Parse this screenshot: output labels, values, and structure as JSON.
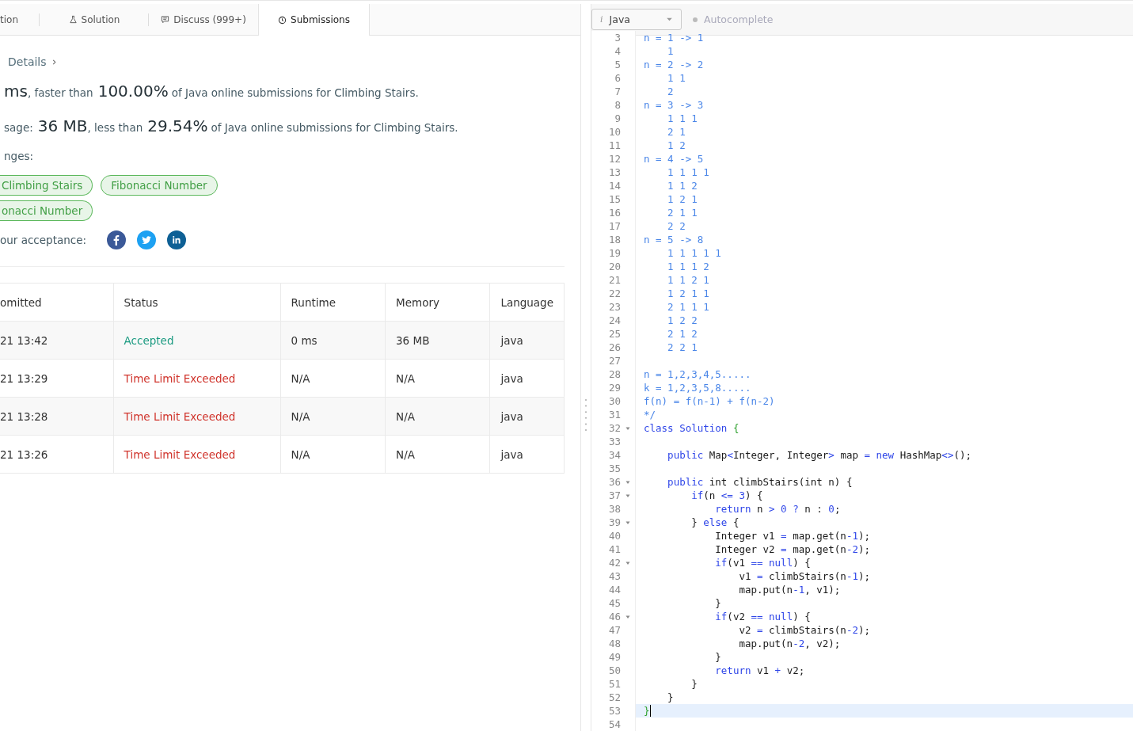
{
  "tabs": [
    {
      "label": "tion",
      "selected": false
    },
    {
      "label": "Solution",
      "selected": false
    },
    {
      "label": "Discuss (999+)",
      "selected": false
    },
    {
      "label": "Submissions",
      "selected": true
    }
  ],
  "details_link": "Details",
  "runtime": {
    "value": "ms",
    "mid": ", faster than",
    "percent": "100.00%",
    "suffix": "of Java online submissions for Climbing Stairs."
  },
  "memory": {
    "label": "sage:",
    "value": "36 MB",
    "mid": ", less than",
    "percent": "29.54%",
    "suffix": "of Java online submissions for Climbing Stairs."
  },
  "challenges": {
    "label": "nges:",
    "tag_rows": [
      [
        "Climbing Stairs",
        "Fibonacci Number"
      ],
      [
        "onacci Number"
      ]
    ]
  },
  "share": {
    "label": "our acceptance:",
    "networks": [
      {
        "kind": "facebook",
        "color": "#3b5998"
      },
      {
        "kind": "twitter",
        "color": "#1da1f2"
      },
      {
        "kind": "linkedin",
        "color": "#0e6095"
      }
    ]
  },
  "table": {
    "columns": [
      "omitted",
      "Status",
      "Runtime",
      "Memory",
      "Language"
    ],
    "rows": [
      {
        "submitted": "21 13:42",
        "status": "Accepted",
        "kind": "accepted",
        "runtime": "0 ms",
        "memory": "36 MB",
        "language": "java"
      },
      {
        "submitted": "21 13:29",
        "status": "Time Limit Exceeded",
        "kind": "error",
        "runtime": "N/A",
        "memory": "N/A",
        "language": "java"
      },
      {
        "submitted": "21 13:28",
        "status": "Time Limit Exceeded",
        "kind": "error",
        "runtime": "N/A",
        "memory": "N/A",
        "language": "java"
      },
      {
        "submitted": "21 13:26",
        "status": "Time Limit Exceeded",
        "kind": "error",
        "runtime": "N/A",
        "memory": "N/A",
        "language": "java"
      }
    ]
  },
  "editor": {
    "language_icon": "i",
    "language": "Java",
    "autocomplete": {
      "label": "Autocomplete",
      "on": false
    },
    "lines": [
      {
        "number": "3",
        "fold": false,
        "current": false,
        "tokens": [
          {
            "kind": "comment",
            "text": "n = 1 -> 1"
          }
        ]
      },
      {
        "number": "4",
        "fold": false,
        "current": false,
        "tokens": [
          {
            "kind": "comment",
            "text": "    1"
          }
        ]
      },
      {
        "number": "5",
        "fold": false,
        "current": false,
        "tokens": [
          {
            "kind": "comment",
            "text": "n = 2 -> 2"
          }
        ]
      },
      {
        "number": "6",
        "fold": false,
        "current": false,
        "tokens": [
          {
            "kind": "comment",
            "text": "    1 1"
          }
        ]
      },
      {
        "number": "7",
        "fold": false,
        "current": false,
        "tokens": [
          {
            "kind": "comment",
            "text": "    2"
          }
        ]
      },
      {
        "number": "8",
        "fold": false,
        "current": false,
        "tokens": [
          {
            "kind": "comment",
            "text": "n = 3 -> 3"
          }
        ]
      },
      {
        "number": "9",
        "fold": false,
        "current": false,
        "tokens": [
          {
            "kind": "comment",
            "text": "    1 1 1"
          }
        ]
      },
      {
        "number": "10",
        "fold": false,
        "current": false,
        "tokens": [
          {
            "kind": "comment",
            "text": "    2 1"
          }
        ]
      },
      {
        "number": "11",
        "fold": false,
        "current": false,
        "tokens": [
          {
            "kind": "comment",
            "text": "    1 2"
          }
        ]
      },
      {
        "number": "12",
        "fold": false,
        "current": false,
        "tokens": [
          {
            "kind": "comment",
            "text": "n = 4 -> 5"
          }
        ]
      },
      {
        "number": "13",
        "fold": false,
        "current": false,
        "tokens": [
          {
            "kind": "comment",
            "text": "    1 1 1 1"
          }
        ]
      },
      {
        "number": "14",
        "fold": false,
        "current": false,
        "tokens": [
          {
            "kind": "comment",
            "text": "    1 1 2"
          }
        ]
      },
      {
        "number": "15",
        "fold": false,
        "current": false,
        "tokens": [
          {
            "kind": "comment",
            "text": "    1 2 1"
          }
        ]
      },
      {
        "number": "16",
        "fold": false,
        "current": false,
        "tokens": [
          {
            "kind": "comment",
            "text": "    2 1 1"
          }
        ]
      },
      {
        "number": "17",
        "fold": false,
        "current": false,
        "tokens": [
          {
            "kind": "comment",
            "text": "    2 2"
          }
        ]
      },
      {
        "number": "18",
        "fold": false,
        "current": false,
        "tokens": [
          {
            "kind": "comment",
            "text": "n = 5 -> 8"
          }
        ]
      },
      {
        "number": "19",
        "fold": false,
        "current": false,
        "tokens": [
          {
            "kind": "comment",
            "text": "    1 1 1 1 1"
          }
        ]
      },
      {
        "number": "20",
        "fold": false,
        "current": false,
        "tokens": [
          {
            "kind": "comment",
            "text": "    1 1 1 2"
          }
        ]
      },
      {
        "number": "21",
        "fold": false,
        "current": false,
        "tokens": [
          {
            "kind": "comment",
            "text": "    1 1 2 1"
          }
        ]
      },
      {
        "number": "22",
        "fold": false,
        "current": false,
        "tokens": [
          {
            "kind": "comment",
            "text": "    1 2 1 1"
          }
        ]
      },
      {
        "number": "23",
        "fold": false,
        "current": false,
        "tokens": [
          {
            "kind": "comment",
            "text": "    2 1 1 1"
          }
        ]
      },
      {
        "number": "24",
        "fold": false,
        "current": false,
        "tokens": [
          {
            "kind": "comment",
            "text": "    1 2 2"
          }
        ]
      },
      {
        "number": "25",
        "fold": false,
        "current": false,
        "tokens": [
          {
            "kind": "comment",
            "text": "    2 1 2"
          }
        ]
      },
      {
        "number": "26",
        "fold": false,
        "current": false,
        "tokens": [
          {
            "kind": "comment",
            "text": "    2 2 1"
          }
        ]
      },
      {
        "number": "27",
        "fold": false,
        "current": false
      },
      {
        "number": "28",
        "fold": false,
        "current": false,
        "tokens": [
          {
            "kind": "comment",
            "text": "n = 1,2,3,4,5....."
          }
        ]
      },
      {
        "number": "29",
        "fold": false,
        "current": false,
        "tokens": [
          {
            "kind": "comment",
            "text": "k = 1,2,3,5,8....."
          }
        ]
      },
      {
        "number": "30",
        "fold": false,
        "current": false,
        "tokens": [
          {
            "kind": "comment",
            "text": "f(n) = f(n-1) + f(n-2)"
          }
        ]
      },
      {
        "number": "31",
        "fold": false,
        "current": false,
        "tokens": [
          {
            "kind": "comment",
            "text": "*/"
          }
        ]
      },
      {
        "number": "32",
        "fold": true,
        "current": false,
        "tokens": [
          {
            "kind": "keyword",
            "text": "class Solution "
          },
          {
            "kind": "brace",
            "text": "{"
          }
        ]
      },
      {
        "number": "33",
        "fold": false,
        "current": false
      },
      {
        "number": "34",
        "fold": false,
        "current": false,
        "tokens": [
          {
            "kind": "keyword",
            "text": "    public"
          },
          {
            "kind": "plain",
            "text": " Map"
          },
          {
            "kind": "keyword",
            "text": "<"
          },
          {
            "kind": "plain",
            "text": "Integer, Integer"
          },
          {
            "kind": "keyword",
            "text": ">"
          },
          {
            "kind": "plain",
            "text": " map "
          },
          {
            "kind": "keyword",
            "text": "="
          },
          {
            "kind": "keyword",
            "text": " new"
          },
          {
            "kind": "plain",
            "text": " HashMap"
          },
          {
            "kind": "keyword",
            "text": "<>"
          },
          {
            "kind": "plain",
            "text": "();"
          }
        ]
      },
      {
        "number": "35",
        "fold": false,
        "current": false
      },
      {
        "number": "36",
        "fold": true,
        "current": false,
        "tokens": [
          {
            "kind": "keyword",
            "text": "    public"
          },
          {
            "kind": "plain",
            "text": " int climbStairs(int n) {"
          }
        ]
      },
      {
        "number": "37",
        "fold": true,
        "current": false,
        "tokens": [
          {
            "kind": "keyword",
            "text": "        if"
          },
          {
            "kind": "plain",
            "text": "(n "
          },
          {
            "kind": "keyword",
            "text": "<="
          },
          {
            "kind": "number",
            "text": " 3"
          },
          {
            "kind": "plain",
            "text": ") {"
          }
        ]
      },
      {
        "number": "38",
        "fold": false,
        "current": false,
        "tokens": [
          {
            "kind": "keyword",
            "text": "            return"
          },
          {
            "kind": "plain",
            "text": " n "
          },
          {
            "kind": "keyword",
            "text": ">"
          },
          {
            "kind": "number",
            "text": " 0"
          },
          {
            "kind": "keyword",
            "text": " ?"
          },
          {
            "kind": "plain",
            "text": " n : "
          },
          {
            "kind": "number",
            "text": "0"
          },
          {
            "kind": "plain",
            "text": ";"
          }
        ]
      },
      {
        "number": "39",
        "fold": true,
        "current": false,
        "tokens": [
          {
            "kind": "plain",
            "text": "        } "
          },
          {
            "kind": "keyword",
            "text": "else"
          },
          {
            "kind": "plain",
            "text": " {"
          }
        ]
      },
      {
        "number": "40",
        "fold": false,
        "current": false,
        "tokens": [
          {
            "kind": "plain",
            "text": "            Integer v1 "
          },
          {
            "kind": "keyword",
            "text": "="
          },
          {
            "kind": "plain",
            "text": " map.get(n"
          },
          {
            "kind": "keyword",
            "text": "-"
          },
          {
            "kind": "number",
            "text": "1"
          },
          {
            "kind": "plain",
            "text": ");"
          }
        ]
      },
      {
        "number": "41",
        "fold": false,
        "current": false,
        "tokens": [
          {
            "kind": "plain",
            "text": "            Integer v2 "
          },
          {
            "kind": "keyword",
            "text": "="
          },
          {
            "kind": "plain",
            "text": " map.get(n"
          },
          {
            "kind": "keyword",
            "text": "-"
          },
          {
            "kind": "number",
            "text": "2"
          },
          {
            "kind": "plain",
            "text": ");"
          }
        ]
      },
      {
        "number": "42",
        "fold": true,
        "current": false,
        "tokens": [
          {
            "kind": "keyword",
            "text": "            if"
          },
          {
            "kind": "plain",
            "text": "(v1 "
          },
          {
            "kind": "keyword",
            "text": "=="
          },
          {
            "kind": "keyword",
            "text": " null"
          },
          {
            "kind": "plain",
            "text": ") {"
          }
        ]
      },
      {
        "number": "43",
        "fold": false,
        "current": false,
        "tokens": [
          {
            "kind": "plain",
            "text": "                v1 "
          },
          {
            "kind": "keyword",
            "text": "="
          },
          {
            "kind": "plain",
            "text": " climbStairs(n"
          },
          {
            "kind": "keyword",
            "text": "-"
          },
          {
            "kind": "number",
            "text": "1"
          },
          {
            "kind": "plain",
            "text": ");"
          }
        ]
      },
      {
        "number": "44",
        "fold": false,
        "current": false,
        "tokens": [
          {
            "kind": "plain",
            "text": "                map.put(n"
          },
          {
            "kind": "keyword",
            "text": "-"
          },
          {
            "kind": "number",
            "text": "1"
          },
          {
            "kind": "plain",
            "text": ", v1);"
          }
        ]
      },
      {
        "number": "45",
        "fold": false,
        "current": false,
        "tokens": [
          {
            "kind": "plain",
            "text": "            }"
          }
        ]
      },
      {
        "number": "46",
        "fold": true,
        "current": false,
        "tokens": [
          {
            "kind": "keyword",
            "text": "            if"
          },
          {
            "kind": "plain",
            "text": "(v2 "
          },
          {
            "kind": "keyword",
            "text": "=="
          },
          {
            "kind": "keyword",
            "text": " null"
          },
          {
            "kind": "plain",
            "text": ") {"
          }
        ]
      },
      {
        "number": "47",
        "fold": false,
        "current": false,
        "tokens": [
          {
            "kind": "plain",
            "text": "                v2 "
          },
          {
            "kind": "keyword",
            "text": "="
          },
          {
            "kind": "plain",
            "text": " climbStairs(n"
          },
          {
            "kind": "keyword",
            "text": "-"
          },
          {
            "kind": "number",
            "text": "2"
          },
          {
            "kind": "plain",
            "text": ");"
          }
        ]
      },
      {
        "number": "48",
        "fold": false,
        "current": false,
        "tokens": [
          {
            "kind": "plain",
            "text": "                map.put(n"
          },
          {
            "kind": "keyword",
            "text": "-"
          },
          {
            "kind": "number",
            "text": "2"
          },
          {
            "kind": "plain",
            "text": ", v2);"
          }
        ]
      },
      {
        "number": "49",
        "fold": false,
        "current": false,
        "tokens": [
          {
            "kind": "plain",
            "text": "            }"
          }
        ]
      },
      {
        "number": "50",
        "fold": false,
        "current": false,
        "tokens": [
          {
            "kind": "keyword",
            "text": "            return"
          },
          {
            "kind": "plain",
            "text": " v1 "
          },
          {
            "kind": "keyword",
            "text": "+"
          },
          {
            "kind": "plain",
            "text": " v2;"
          }
        ]
      },
      {
        "number": "51",
        "fold": false,
        "current": false,
        "tokens": [
          {
            "kind": "plain",
            "text": "        }"
          }
        ]
      },
      {
        "number": "52",
        "fold": false,
        "current": false,
        "tokens": [
          {
            "kind": "plain",
            "text": "    }"
          }
        ]
      },
      {
        "number": "53",
        "fold": false,
        "current": true,
        "tokens": [
          {
            "kind": "brace",
            "text": "}"
          }
        ]
      },
      {
        "number": "54",
        "fold": false,
        "current": false
      }
    ]
  }
}
